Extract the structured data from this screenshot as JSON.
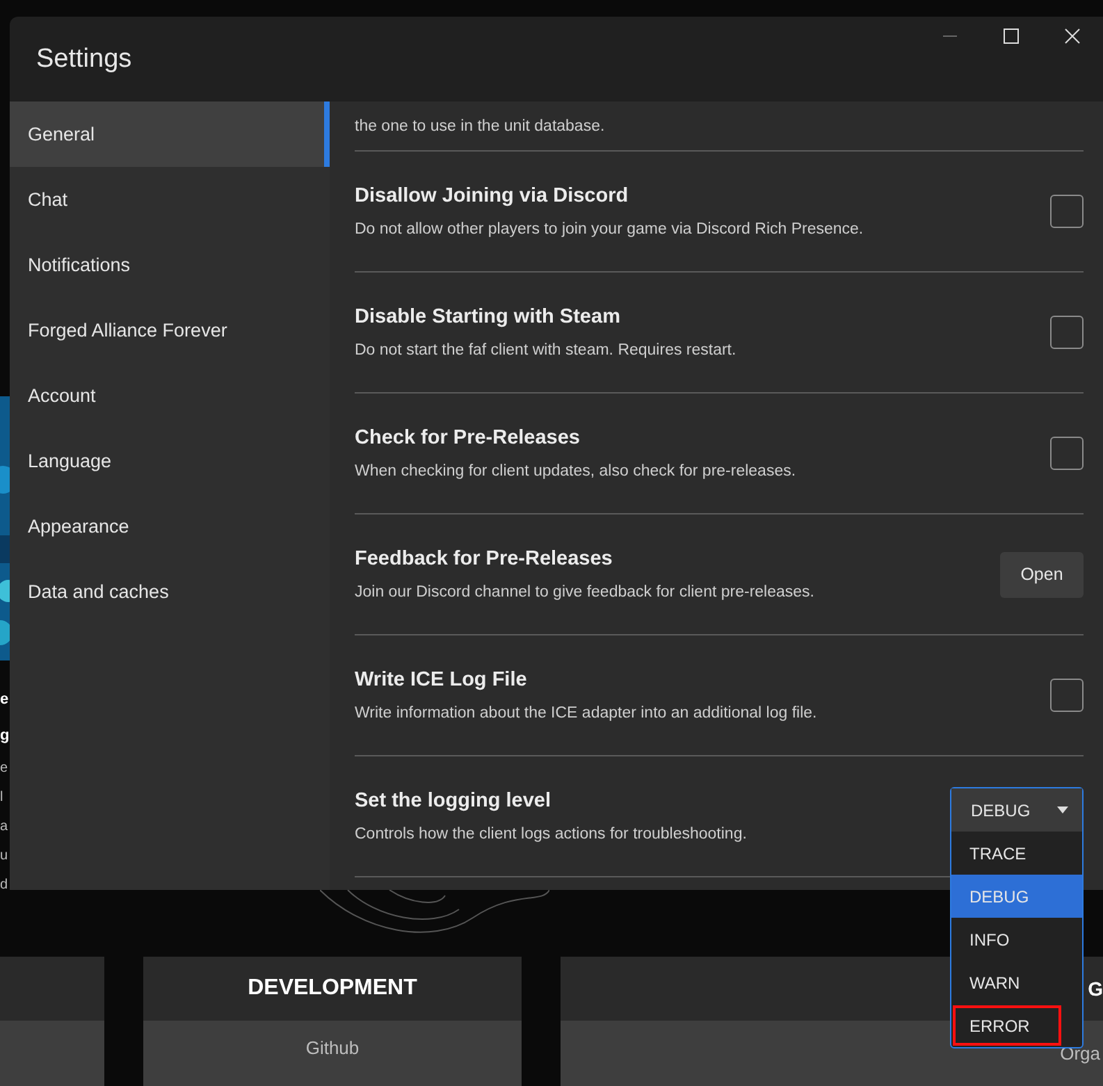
{
  "background": {
    "left_fragments": [
      "e",
      "g",
      "e",
      "l",
      "a",
      "u",
      "d"
    ],
    "panels": [
      {
        "heading": "DEVELOPMENT",
        "link": "Github"
      },
      {
        "heading": "G",
        "link": "Orga"
      }
    ]
  },
  "window": {
    "title": "Settings"
  },
  "sidebar": {
    "items": [
      {
        "label": "General",
        "selected": true
      },
      {
        "label": "Chat",
        "selected": false
      },
      {
        "label": "Notifications",
        "selected": false
      },
      {
        "label": "Forged Alliance Forever",
        "selected": false
      },
      {
        "label": "Account",
        "selected": false
      },
      {
        "label": "Language",
        "selected": false
      },
      {
        "label": "Appearance",
        "selected": false
      },
      {
        "label": "Data and caches",
        "selected": false
      }
    ]
  },
  "settings": [
    {
      "kind": "note",
      "description": "the one to use in the unit database."
    },
    {
      "kind": "checkbox",
      "title": "Disallow Joining via Discord",
      "description": "Do not allow other players to join your game via Discord Rich Presence.",
      "checked": false
    },
    {
      "kind": "checkbox",
      "title": "Disable Starting with Steam",
      "description": "Do not start the faf client with steam. Requires restart.",
      "checked": false
    },
    {
      "kind": "checkbox",
      "title": "Check for Pre-Releases",
      "description": "When checking for client updates, also check for pre-releases.",
      "checked": false
    },
    {
      "kind": "button",
      "title": "Feedback for Pre-Releases",
      "description": "Join our Discord channel to give feedback for client pre-releases.",
      "button": "Open"
    },
    {
      "kind": "checkbox",
      "title": "Write ICE Log File",
      "description": "Write information about the ICE adapter into an additional log file.",
      "checked": false
    },
    {
      "kind": "dropdown",
      "title": "Set the logging level",
      "description": "Controls how the client logs actions for troubleshooting.",
      "value": "DEBUG",
      "expanded": true,
      "options": [
        {
          "label": "TRACE",
          "selected": false,
          "highlighted": false
        },
        {
          "label": "DEBUG",
          "selected": true,
          "highlighted": false
        },
        {
          "label": "INFO",
          "selected": false,
          "highlighted": false
        },
        {
          "label": "WARN",
          "selected": false,
          "highlighted": false
        },
        {
          "label": "ERROR",
          "selected": false,
          "highlighted": true
        }
      ]
    }
  ]
}
